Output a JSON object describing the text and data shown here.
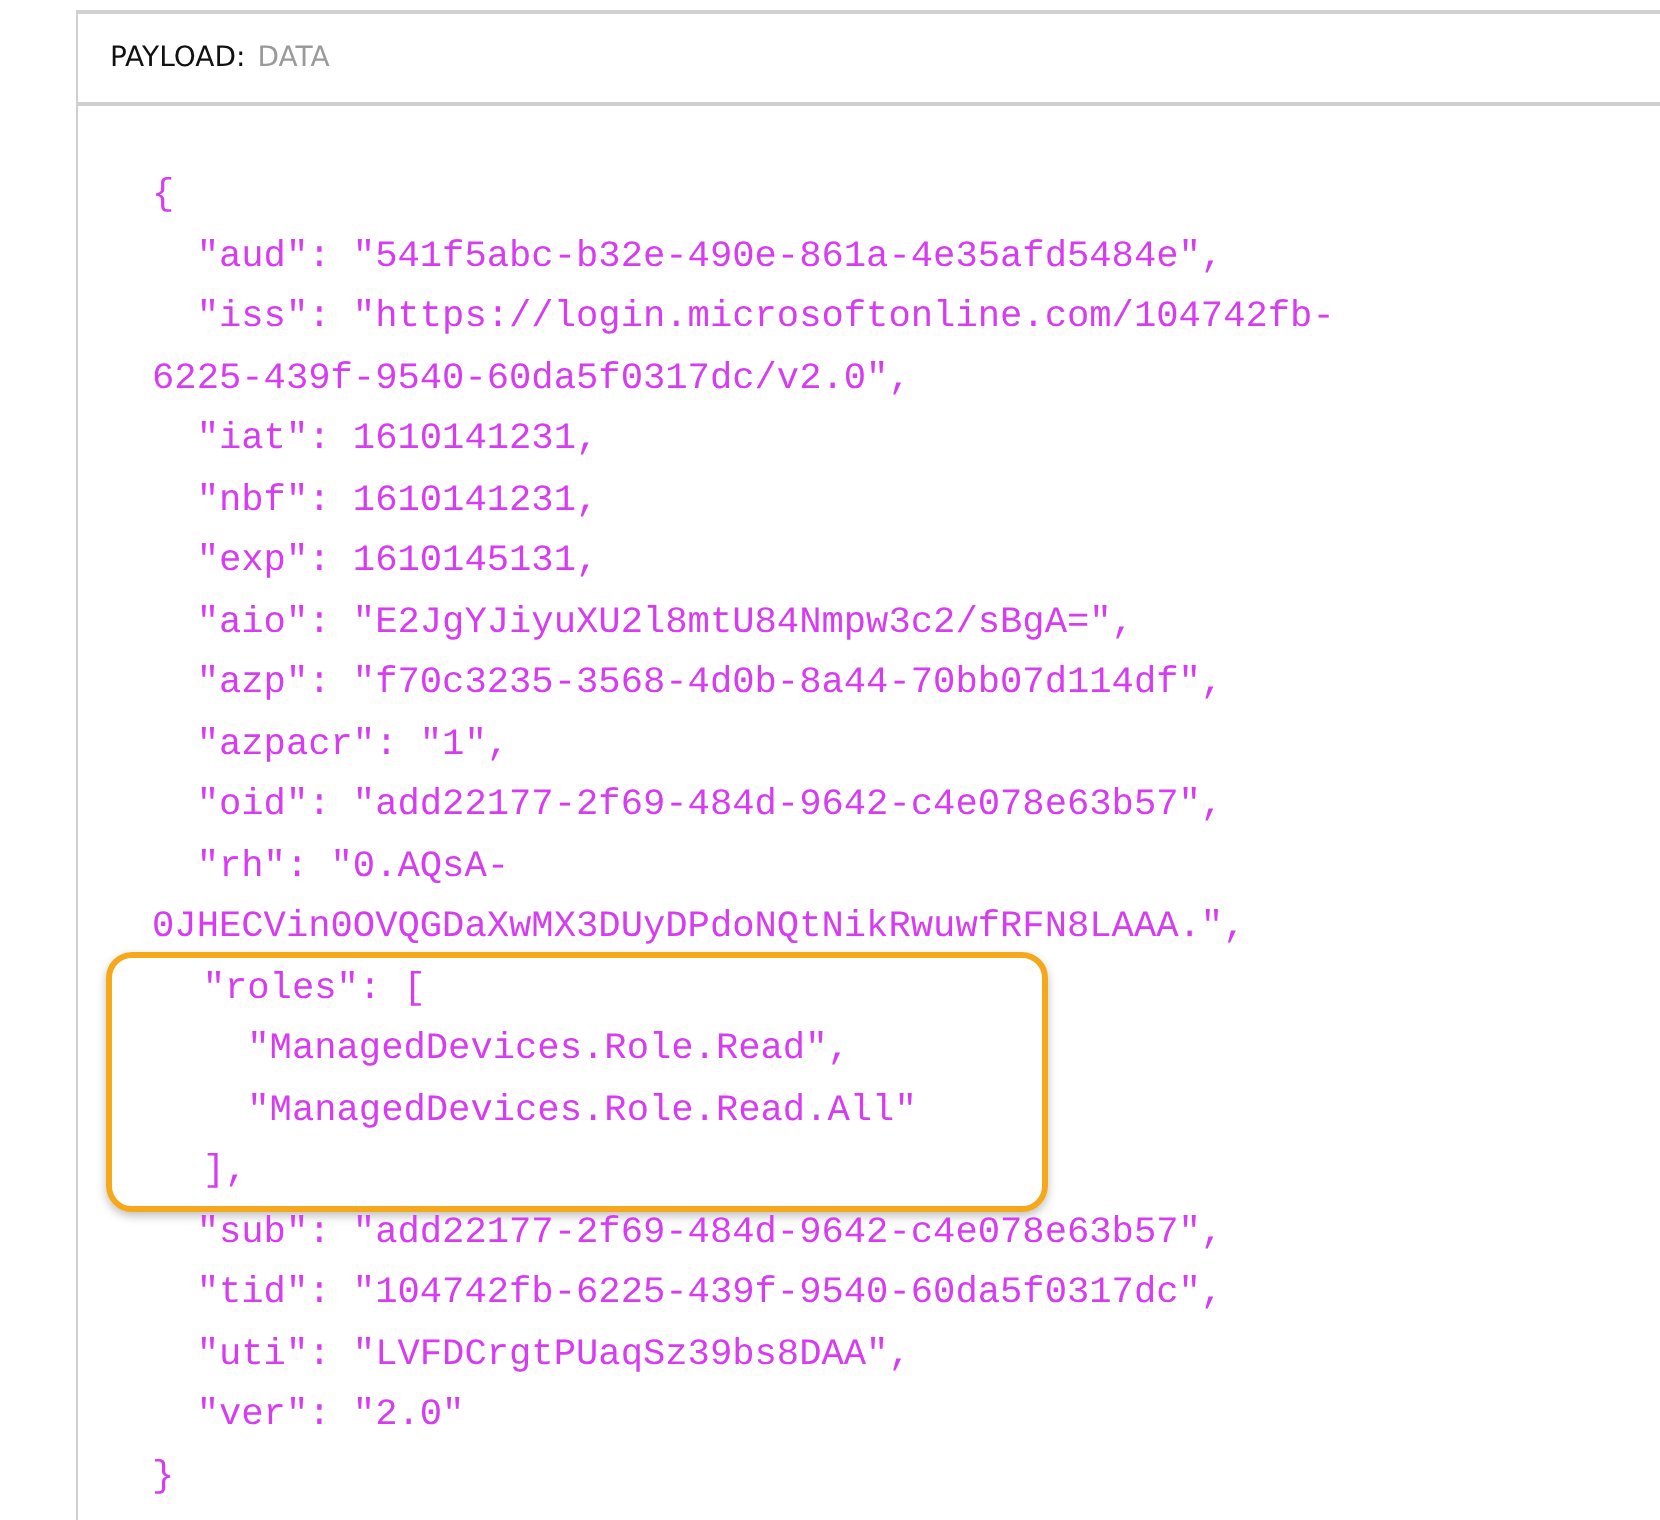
{
  "header": {
    "label": "PAYLOAD:",
    "value": "DATA"
  },
  "code": {
    "before": [
      "{",
      "  \"aud\": \"541f5abc-b32e-490e-861a-4e35afd5484e\",",
      "  \"iss\": \"https://login.microsoftonline.com/104742fb-",
      "6225-439f-9540-60da5f0317dc/v2.0\",",
      "  \"iat\": 1610141231,",
      "  \"nbf\": 1610141231,",
      "  \"exp\": 1610145131,",
      "  \"aio\": \"E2JgYJiyuXU2l8mtU84Nmpw3c2/sBgA=\",",
      "  \"azp\": \"f70c3235-3568-4d0b-8a44-70bb07d114df\",",
      "  \"azpacr\": \"1\",",
      "  \"oid\": \"add22177-2f69-484d-9642-c4e078e63b57\",",
      "  \"rh\": \"0.AQsA-",
      "0JHECVin0OVQGDaXwMX3DUyDPdoNQtNikRwuwfRFN8LAAA.\","
    ],
    "highlight": [
      "  \"roles\": [",
      "    \"ManagedDevices.Role.Read\",",
      "    \"ManagedDevices.Role.Read.All\"",
      "  ],"
    ],
    "after": [
      "  \"sub\": \"add22177-2f69-484d-9642-c4e078e63b57\",",
      "  \"tid\": \"104742fb-6225-439f-9540-60da5f0317dc\",",
      "  \"uti\": \"LVFDCrgtPUaqSz39bs8DAA\",",
      "  \"ver\": \"2.0\"",
      "}"
    ]
  }
}
